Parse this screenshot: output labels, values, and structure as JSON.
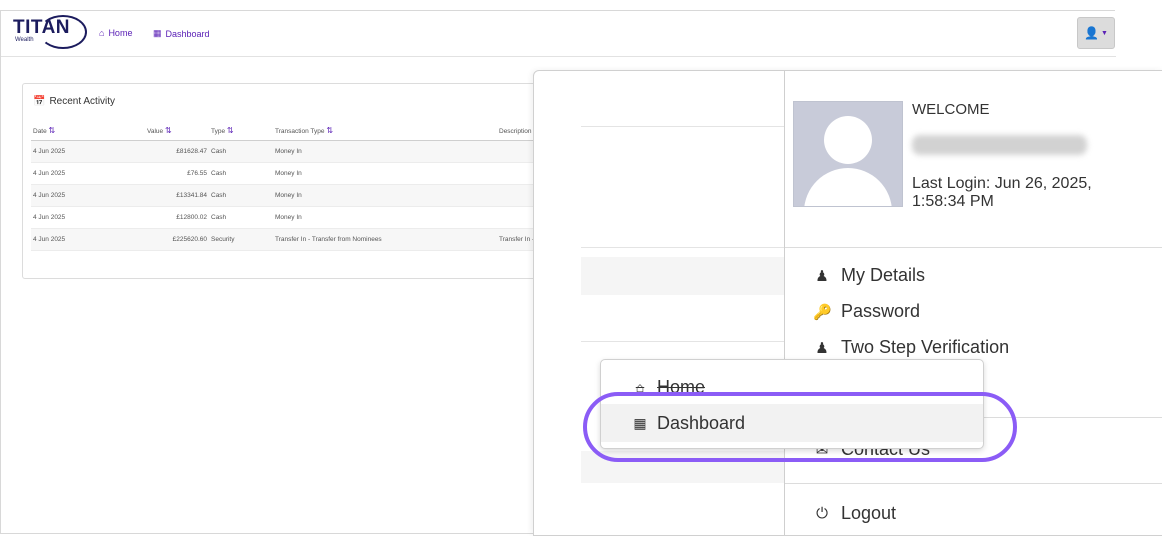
{
  "navbar": {
    "logo_text": "TITAN",
    "logo_sub": "Wealth",
    "home_label": "Home",
    "dashboard_label": "Dashboard",
    "home_icon": "home-icon",
    "dashboard_icon": "grid-icon",
    "user_icon": "user-icon",
    "accent_color": "#5b21b6"
  },
  "recent_activity": {
    "title": "Recent Activity",
    "columns": [
      "Date",
      "Value",
      "Type",
      "Transaction Type",
      "Description"
    ],
    "rows": [
      {
        "date": "4 Jun 2025",
        "value": "£81628.47",
        "type": "Cash",
        "txn_type": "Money In",
        "description": ""
      },
      {
        "date": "4 Jun 2025",
        "value": "£76.55",
        "type": "Cash",
        "txn_type": "Money In",
        "description": ""
      },
      {
        "date": "4 Jun 2025",
        "value": "£13341.84",
        "type": "Cash",
        "txn_type": "Money In",
        "description": ""
      },
      {
        "date": "4 Jun 2025",
        "value": "£12800.02",
        "type": "Cash",
        "txn_type": "Money In",
        "description": ""
      },
      {
        "date": "4 Jun 2025",
        "value": "£225620.60",
        "type": "Security",
        "txn_type": "Transfer In - Transfer from Nominees",
        "description": "Transfer In - Transfer fro"
      }
    ]
  },
  "user_menu": {
    "welcome": "WELCOME",
    "last_login": "Last Login: Jun 26, 2025, 1:58:34 PM",
    "items": [
      {
        "label": "My Details",
        "icon": "user-secret-icon"
      },
      {
        "label": "Password",
        "icon": "key-icon"
      },
      {
        "label": "Two Step Verification",
        "icon": "user-secret-icon"
      },
      {
        "label": "Contact Us",
        "icon": "envelope-icon"
      },
      {
        "label": "Logout",
        "icon": "power-icon"
      }
    ]
  },
  "floating_menu": {
    "home_label": "Home",
    "dashboard_label": "Dashboard",
    "highlight_color": "#8b5cf6"
  }
}
